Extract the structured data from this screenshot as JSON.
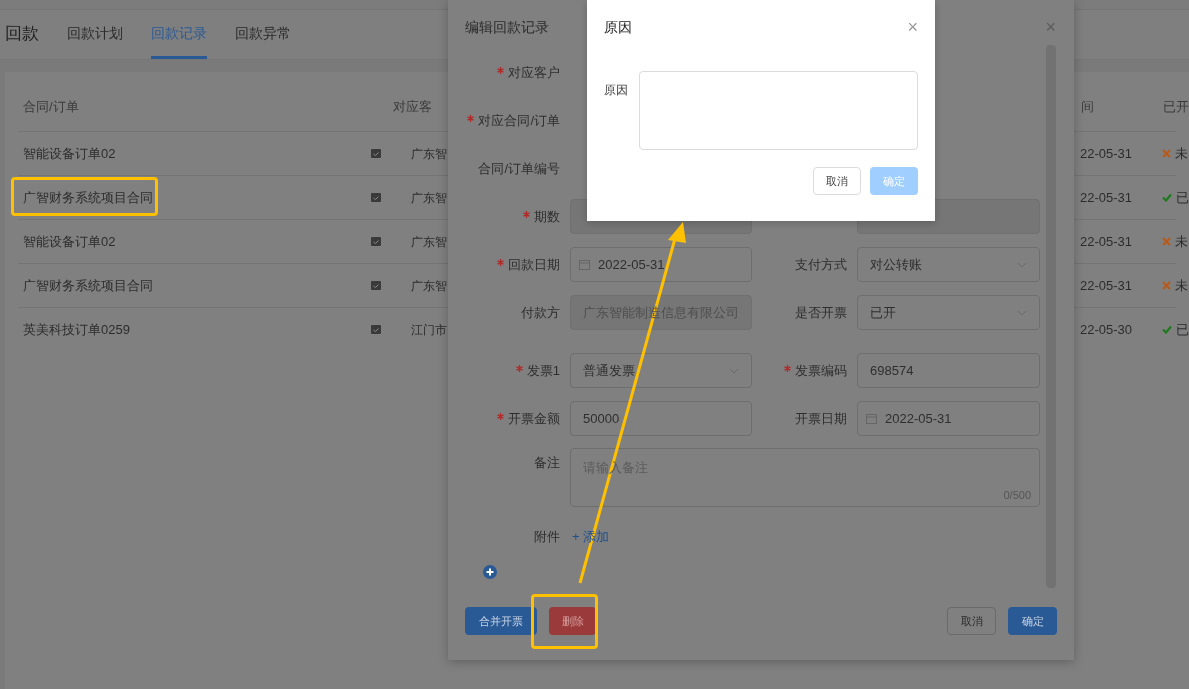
{
  "page": {
    "title": "回款",
    "tabs": [
      {
        "label": "回款计划",
        "selected": false
      },
      {
        "label": "回款记录",
        "selected": true
      },
      {
        "label": "回款异常",
        "selected": false
      }
    ]
  },
  "table": {
    "columns": [
      "合同/订单",
      "对应客",
      "间",
      "已开"
    ],
    "rows": [
      {
        "name": "智能设备订单02",
        "customer": "广东智",
        "date": "22-05-31",
        "invoiced": false,
        "status": "未"
      },
      {
        "name": "广智财务系统项目合同",
        "customer": "广东智",
        "date": "22-05-31",
        "invoiced": true,
        "status": "已"
      },
      {
        "name": "智能设备订单02",
        "customer": "广东智",
        "date": "22-05-31",
        "invoiced": false,
        "status": "未"
      },
      {
        "name": "广智财务系统项目合同",
        "customer": "广东智",
        "date": "22-05-31",
        "invoiced": false,
        "status": "未"
      },
      {
        "name": "英美科技订单0259",
        "customer": "江门市",
        "date": "22-05-30",
        "invoiced": true,
        "status": "已"
      }
    ]
  },
  "edit_dialog": {
    "title": "编辑回款记录",
    "close": "×",
    "rows": [
      [
        {
          "kind": "label_only",
          "label": "对应客户",
          "required": true
        }
      ],
      [
        {
          "kind": "label_only",
          "label": "对应合同/订单",
          "required": true
        }
      ],
      [
        {
          "kind": "label_only",
          "label": "合同/订单编号",
          "required": false
        }
      ],
      [
        {
          "kind": "disabled",
          "label": "期数",
          "required": true
        },
        {
          "kind": "disabled"
        }
      ],
      [
        {
          "kind": "date",
          "label": "回款日期",
          "required": true,
          "value": "2022-05-31"
        },
        {
          "kind": "select",
          "label": "支付方式",
          "required": false,
          "value": "对公转账"
        }
      ],
      [
        {
          "kind": "disabled",
          "label": "付款方",
          "required": false,
          "value": "广东智能制造信息有限公司"
        },
        {
          "kind": "select",
          "label": "是否开票",
          "required": false,
          "value": "已开"
        }
      ],
      [
        {
          "kind": "select",
          "label": "发票1",
          "required": true,
          "value": "普通发票"
        },
        {
          "kind": "text",
          "label": "发票编码",
          "required": true,
          "value": "698574"
        }
      ],
      [
        {
          "kind": "text",
          "label": "开票金额",
          "required": true,
          "value": "50000"
        },
        {
          "kind": "date",
          "label": "开票日期",
          "required": false,
          "value": "2022-05-31"
        }
      ]
    ],
    "remark": {
      "label": "备注",
      "placeholder": "请输入备注",
      "counter": "0/500"
    },
    "attachment": {
      "label": "附件",
      "link": "+ 添加"
    },
    "buttons": {
      "merge": "合并开票",
      "delete": "删除",
      "cancel": "取消",
      "ok": "确定"
    }
  },
  "reason_dialog": {
    "title": "原因",
    "close": "×",
    "label": "原因",
    "cancel": "取消",
    "ok": "确定",
    "ok_disabled": true
  }
}
